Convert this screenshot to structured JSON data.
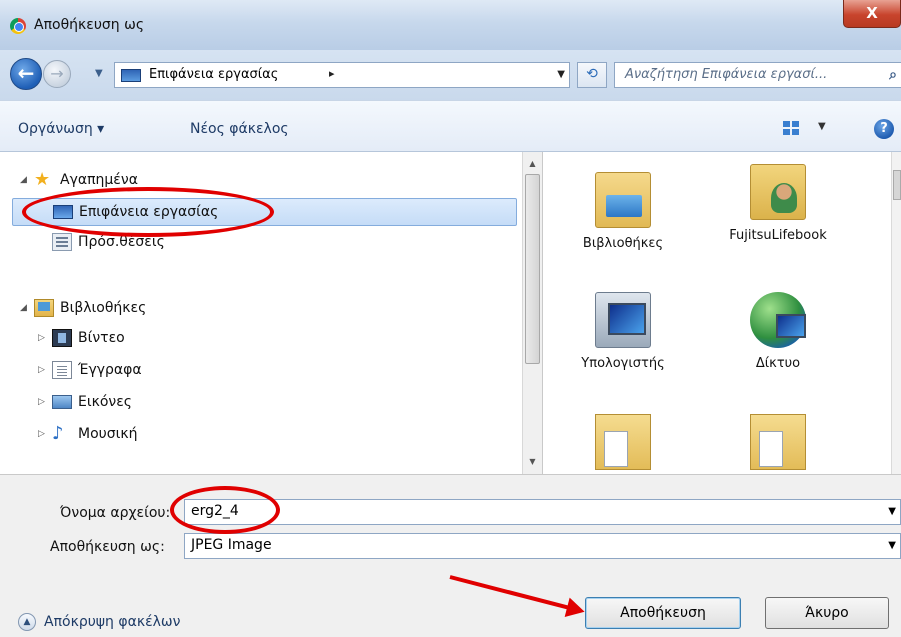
{
  "window": {
    "title": "Αποθήκευση ως",
    "close_label": "X"
  },
  "address": {
    "back_icon": "back-arrow-icon",
    "forward_icon": "forward-arrow-icon",
    "crumb": "Επιφάνεια εργασίας",
    "crumb_arrow": "▸",
    "search_placeholder": "Αναζήτηση Επιφάνεια εργασί..."
  },
  "toolbar": {
    "organize_label": "Οργάνωση ▾",
    "new_folder_label": "Νέος φάκελος",
    "help_label": "?"
  },
  "sidebar": {
    "favorites_label": "Αγαπημένα",
    "items_favorites": [
      {
        "label": "Επιφάνεια εργασίας",
        "selected": true
      },
      {
        "label": "Πρόσ.θέσεις"
      }
    ],
    "libraries_label": "Βιβλιοθήκες",
    "items_libraries": [
      {
        "label": "Βίντεο"
      },
      {
        "label": "Έγγραφα"
      },
      {
        "label": "Εικόνες"
      },
      {
        "label": "Μουσική"
      }
    ]
  },
  "files": [
    {
      "label": "Βιβλιοθήκες",
      "icon": "libraries-folder-icon"
    },
    {
      "label": "FujitsuLifebook",
      "icon": "user-folder-icon"
    },
    {
      "label": "Υπολογιστής",
      "icon": "computer-icon"
    },
    {
      "label": "Δίκτυο",
      "icon": "network-icon"
    },
    {
      "label": "",
      "icon": "folder-icon"
    },
    {
      "label": "",
      "icon": "folder-icon"
    }
  ],
  "form": {
    "filename_label": "Όνομα αρχείου:",
    "filename_value": "erg2_4",
    "savetype_label": "Αποθήκευση ως:",
    "savetype_value": "JPEG Image"
  },
  "buttons": {
    "save_label": "Αποθήκευση",
    "cancel_label": "Άκυρο",
    "hide_folders_label": "Απόκρυψη φακέλων"
  },
  "colors": {
    "annotation_red": "#e00000",
    "selection_blue": "#c5dcf7"
  }
}
